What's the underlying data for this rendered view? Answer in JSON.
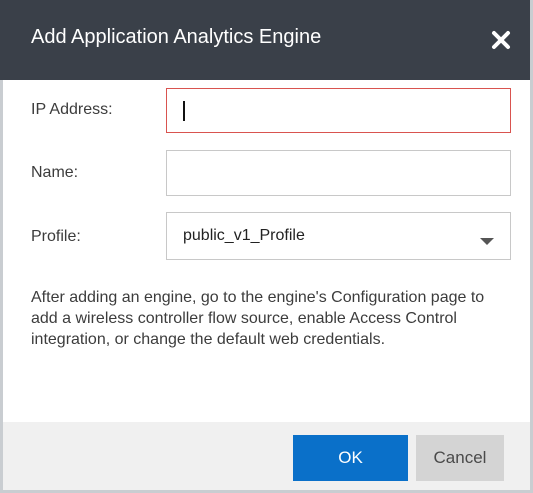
{
  "dialog": {
    "title": "Add Application Analytics Engine",
    "close_icon": "close-x-icon"
  },
  "form": {
    "ip_address": {
      "label": "IP Address:",
      "value": ""
    },
    "name": {
      "label": "Name:",
      "value": ""
    },
    "profile": {
      "label": "Profile:",
      "selected": "public_v1_Profile",
      "arrow_icon": "dropdown-arrow-icon"
    }
  },
  "description": "After adding an engine, go to the engine's Configuration page to add a wireless controller flow source, enable Access Control integration, or change the default web credentials.",
  "buttons": {
    "ok": "OK",
    "cancel": "Cancel"
  },
  "colors": {
    "titlebar": "#3a4049",
    "primary": "#0a70c9",
    "focus_border": "#d9534f",
    "footer": "#f0f0f0"
  }
}
